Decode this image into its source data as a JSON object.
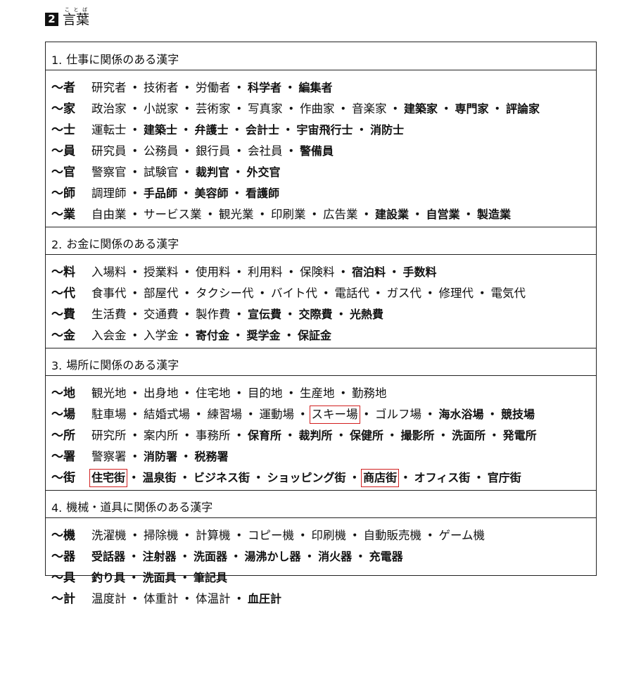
{
  "section": {
    "number": "2",
    "title": "言葉",
    "title_ruby": "ことば"
  },
  "categories": [
    {
      "number": "1.",
      "title": "仕事に関係のある漢字",
      "rows": [
        {
          "suffix": "〜者",
          "words": [
            {
              "t": "研究者",
              "b": false
            },
            {
              "t": "技術者",
              "b": false
            },
            {
              "t": "労働者",
              "b": false
            },
            {
              "t": "科学者",
              "b": true
            },
            {
              "t": "編集者",
              "b": true
            }
          ]
        },
        {
          "suffix": "〜家",
          "words": [
            {
              "t": "政治家",
              "b": false
            },
            {
              "t": "小説家",
              "b": false
            },
            {
              "t": "芸術家",
              "b": false
            },
            {
              "t": "写真家",
              "b": false
            },
            {
              "t": "作曲家",
              "b": false
            },
            {
              "t": "音楽家",
              "b": false
            },
            {
              "t": "建築家",
              "b": true
            },
            {
              "t": "専門家",
              "b": true
            },
            {
              "t": "評論家",
              "b": true
            }
          ]
        },
        {
          "suffix": "〜士",
          "words": [
            {
              "t": "運転士",
              "b": false
            },
            {
              "t": "建築士",
              "b": true
            },
            {
              "t": "弁護士",
              "b": true
            },
            {
              "t": "会計士",
              "b": true
            },
            {
              "t": "宇宙飛行士",
              "b": true
            },
            {
              "t": "消防士",
              "b": true
            }
          ]
        },
        {
          "suffix": "〜員",
          "words": [
            {
              "t": "研究員",
              "b": false
            },
            {
              "t": "公務員",
              "b": false
            },
            {
              "t": "銀行員",
              "b": false
            },
            {
              "t": "会社員",
              "b": false
            },
            {
              "t": "警備員",
              "b": true
            }
          ]
        },
        {
          "suffix": "〜官",
          "words": [
            {
              "t": "警察官",
              "b": false
            },
            {
              "t": "試験官",
              "b": false
            },
            {
              "t": "裁判官",
              "b": true
            },
            {
              "t": "外交官",
              "b": true
            }
          ]
        },
        {
          "suffix": "〜師",
          "words": [
            {
              "t": "調理師",
              "b": false
            },
            {
              "t": "手品師",
              "b": true
            },
            {
              "t": "美容師",
              "b": true
            },
            {
              "t": "看護師",
              "b": true
            }
          ]
        },
        {
          "suffix": "〜業",
          "words": [
            {
              "t": "自由業",
              "b": false
            },
            {
              "t": "サービス業",
              "b": false
            },
            {
              "t": "観光業",
              "b": false
            },
            {
              "t": "印刷業",
              "b": false
            },
            {
              "t": "広告業",
              "b": false
            },
            {
              "t": "建設業",
              "b": true
            },
            {
              "t": "自営業",
              "b": true
            },
            {
              "t": "製造業",
              "b": true
            }
          ]
        }
      ]
    },
    {
      "number": "2.",
      "title": "お金に関係のある漢字",
      "rows": [
        {
          "suffix": "〜料",
          "words": [
            {
              "t": "入場料",
              "b": false
            },
            {
              "t": "授業料",
              "b": false
            },
            {
              "t": "使用料",
              "b": false
            },
            {
              "t": "利用料",
              "b": false
            },
            {
              "t": "保険料",
              "b": false
            },
            {
              "t": "宿泊料",
              "b": true
            },
            {
              "t": "手数料",
              "b": true
            }
          ]
        },
        {
          "suffix": "〜代",
          "words": [
            {
              "t": "食事代",
              "b": false
            },
            {
              "t": "部屋代",
              "b": false
            },
            {
              "t": "タクシー代",
              "b": false
            },
            {
              "t": "バイト代",
              "b": false
            },
            {
              "t": "電話代",
              "b": false
            },
            {
              "t": "ガス代",
              "b": false
            },
            {
              "t": "修理代",
              "b": false
            },
            {
              "t": "電気代",
              "b": false
            }
          ]
        },
        {
          "suffix": "〜費",
          "words": [
            {
              "t": "生活費",
              "b": false
            },
            {
              "t": "交通費",
              "b": false
            },
            {
              "t": "製作費",
              "b": false
            },
            {
              "t": "宣伝費",
              "b": true
            },
            {
              "t": "交際費",
              "b": true
            },
            {
              "t": "光熱費",
              "b": true
            }
          ]
        },
        {
          "suffix": "〜金",
          "words": [
            {
              "t": "入会金",
              "b": false
            },
            {
              "t": "入学金",
              "b": false
            },
            {
              "t": "寄付金",
              "b": true
            },
            {
              "t": "奨学金",
              "b": true
            },
            {
              "t": "保証金",
              "b": true
            }
          ]
        }
      ]
    },
    {
      "number": "3.",
      "title": "場所に関係のある漢字",
      "rows": [
        {
          "suffix": "〜地",
          "words": [
            {
              "t": "観光地",
              "b": false
            },
            {
              "t": "出身地",
              "b": false
            },
            {
              "t": "住宅地",
              "b": false
            },
            {
              "t": "目的地",
              "b": false
            },
            {
              "t": "生産地",
              "b": false
            },
            {
              "t": "勤務地",
              "b": false
            }
          ]
        },
        {
          "suffix": "〜場",
          "words": [
            {
              "t": "駐車場",
              "b": false
            },
            {
              "t": "結婚式場",
              "b": false
            },
            {
              "t": "練習場",
              "b": false
            },
            {
              "t": "運動場",
              "b": false
            },
            {
              "t": "スキー場",
              "b": false,
              "box": true
            },
            {
              "t": "ゴルフ場",
              "b": false
            },
            {
              "t": "海水浴場",
              "b": true
            },
            {
              "t": "競技場",
              "b": true
            }
          ]
        },
        {
          "suffix": "〜所",
          "words": [
            {
              "t": "研究所",
              "b": false
            },
            {
              "t": "案内所",
              "b": false
            },
            {
              "t": "事務所",
              "b": false
            },
            {
              "t": "保育所",
              "b": true
            },
            {
              "t": "裁判所",
              "b": true
            },
            {
              "t": "保健所",
              "b": true
            },
            {
              "t": "撮影所",
              "b": true
            },
            {
              "t": "洗面所",
              "b": true
            },
            {
              "t": "発電所",
              "b": true
            }
          ]
        },
        {
          "suffix": "〜署",
          "words": [
            {
              "t": "警察署",
              "b": false
            },
            {
              "t": "消防署",
              "b": true
            },
            {
              "t": "税務署",
              "b": true
            }
          ]
        },
        {
          "suffix": "〜街",
          "words": [
            {
              "t": "住宅街",
              "b": true,
              "box": true
            },
            {
              "t": "温泉街",
              "b": true
            },
            {
              "t": "ビジネス街",
              "b": true
            },
            {
              "t": "ショッピング街",
              "b": true
            },
            {
              "t": "商店街",
              "b": true,
              "box": true
            },
            {
              "t": "オフィス街",
              "b": true
            },
            {
              "t": "官庁街",
              "b": true
            }
          ]
        }
      ]
    },
    {
      "number": "4.",
      "title": "機械・道具に関係のある漢字",
      "rows": [
        {
          "suffix": "〜機",
          "words": [
            {
              "t": "洗濯機",
              "b": false
            },
            {
              "t": "掃除機",
              "b": false
            },
            {
              "t": "計算機",
              "b": false
            },
            {
              "t": "コピー機",
              "b": false
            },
            {
              "t": "印刷機",
              "b": false
            },
            {
              "t": "自動販売機",
              "b": false
            },
            {
              "t": "ゲーム機",
              "b": false
            }
          ]
        },
        {
          "suffix": "〜器",
          "words": [
            {
              "t": "受話器",
              "b": true
            },
            {
              "t": "注射器",
              "b": true
            },
            {
              "t": "洗面器",
              "b": true
            },
            {
              "t": "湯沸かし器",
              "b": true
            },
            {
              "t": "消火器",
              "b": true
            },
            {
              "t": "充電器",
              "b": true
            }
          ]
        },
        {
          "suffix": "〜具",
          "words": [
            {
              "t": "釣り具",
              "b": true
            },
            {
              "t": "洗面具",
              "b": true
            },
            {
              "t": "筆記具",
              "b": true
            }
          ]
        },
        {
          "suffix": "〜計",
          "words": [
            {
              "t": "温度計",
              "b": false
            },
            {
              "t": "体重計",
              "b": false
            },
            {
              "t": "体温計",
              "b": false
            },
            {
              "t": "血圧計",
              "b": true
            }
          ]
        }
      ]
    }
  ]
}
